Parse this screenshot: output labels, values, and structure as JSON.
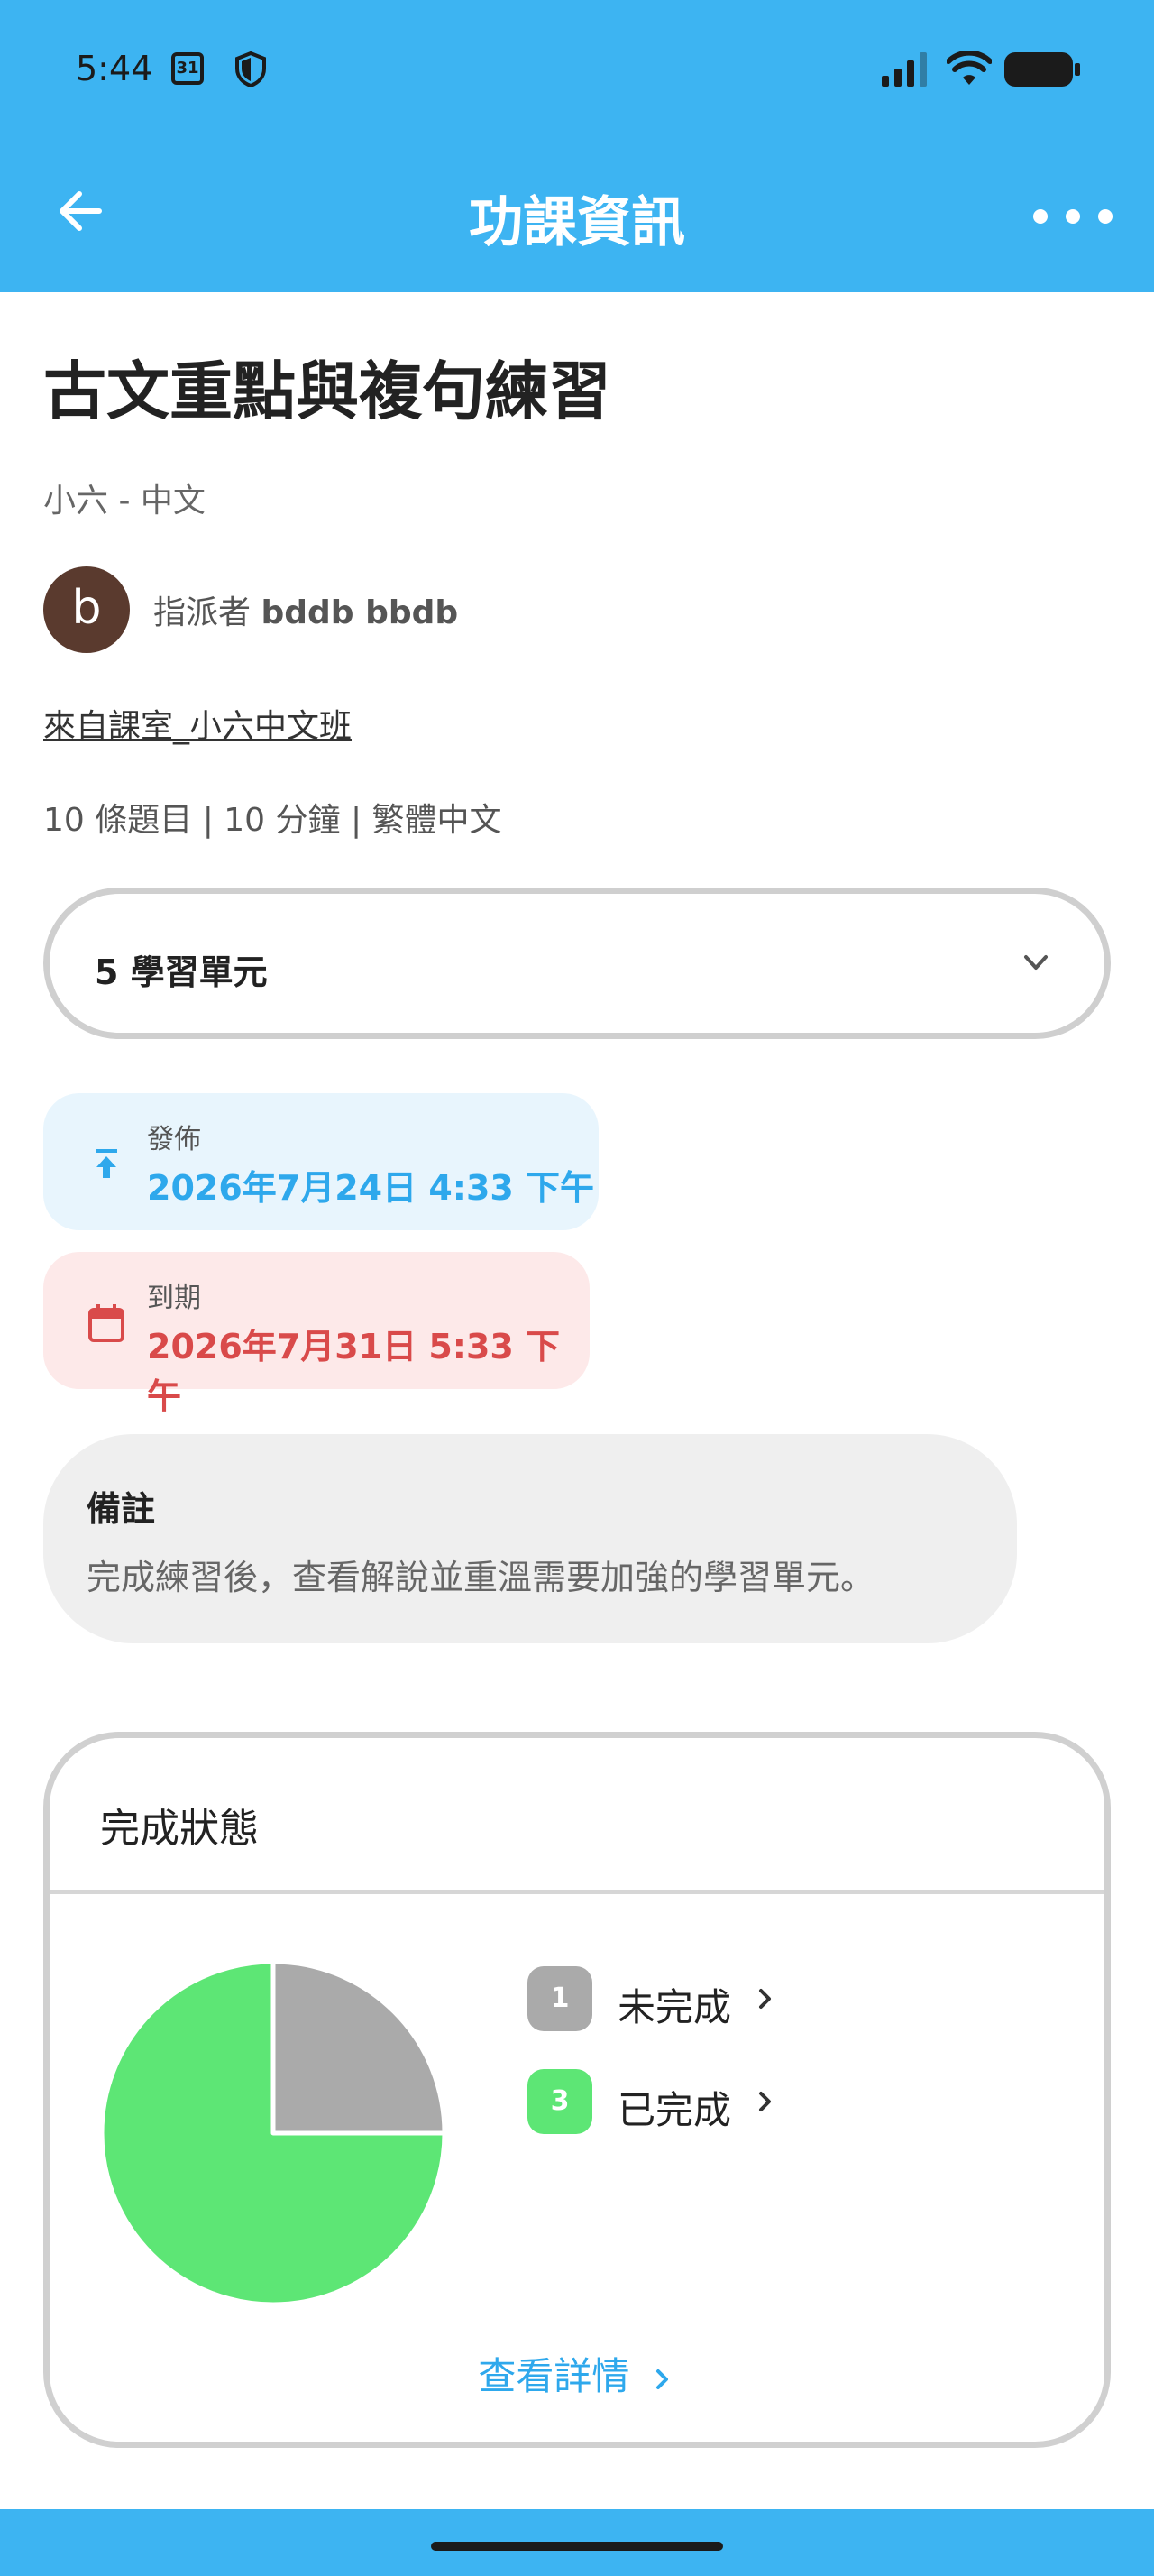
{
  "status_bar": {
    "time": "5:44",
    "calendar_day": "31"
  },
  "header": {
    "title": "功課資訊"
  },
  "assignment": {
    "title": "古文重點與複句練習",
    "subtitle": "小六 - 中文",
    "avatar_letter": "b",
    "assigner_prefix": "指派者",
    "assigner_name": "bddb bbdb",
    "from_class": "來自課室_小六中文班",
    "meta": "10 條題目 | 10 分鐘 | 繁體中文",
    "units_label": "5 學習單元"
  },
  "dates": {
    "publish_label": "發佈",
    "publish_value": "2026年7月24日 4:33 下午",
    "due_label": "到期",
    "due_value": "2026年7月31日 5:33 下午"
  },
  "note": {
    "title": "備註",
    "text": "完成練習後，查看解說並重溫需要加強的學習單元。"
  },
  "completion": {
    "title": "完成狀態",
    "details_link": "查看詳情",
    "chart_data": {
      "type": "pie",
      "slices": [
        {
          "label": "未完成",
          "value": 1,
          "color": "#aaaaaa"
        },
        {
          "label": "已完成",
          "value": 3,
          "color": "#5de675"
        }
      ]
    },
    "legend": [
      {
        "count": "1",
        "label": "未完成",
        "color": "#aaaaaa"
      },
      {
        "count": "3",
        "label": "已完成",
        "color": "#5de675"
      }
    ]
  },
  "colors": {
    "accent": "#3db4f2",
    "publish": "#2ea8ec",
    "due": "#d94a4a"
  }
}
